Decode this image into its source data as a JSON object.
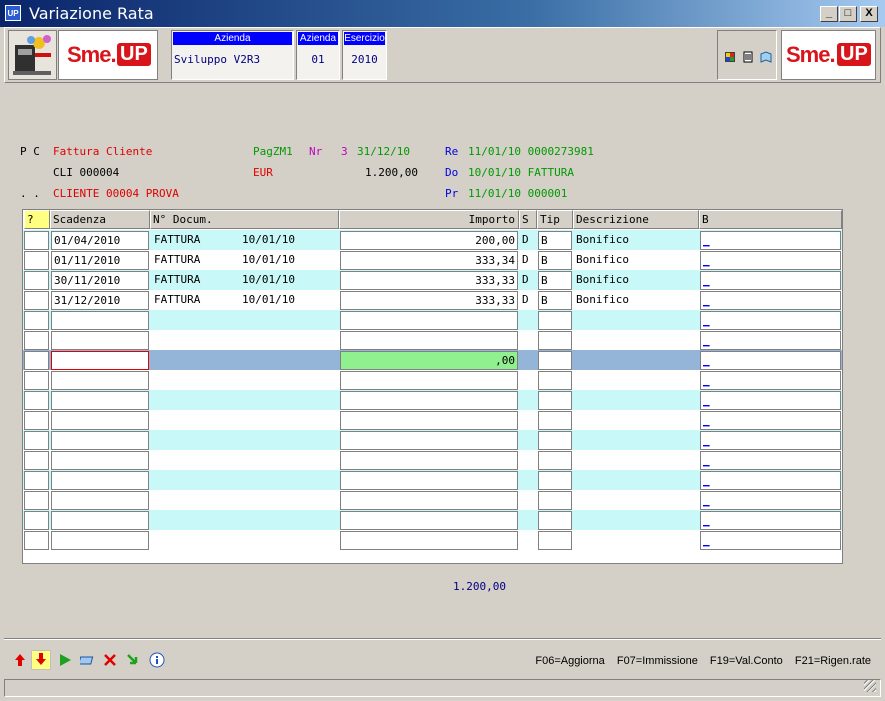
{
  "window": {
    "title": "Variazione Rata",
    "icon_label": "UP",
    "buttons": [
      "_",
      "□",
      "X"
    ]
  },
  "header": {
    "logo_sme": "Sme.",
    "logo_up": "UP",
    "azienda_desc_label": "Azienda",
    "azienda_desc_value": "Sviluppo V2R3",
    "azienda_label": "Azienda",
    "azienda_value": "01",
    "esercizio_label": "Esercizio",
    "esercizio_value": "2010"
  },
  "info": {
    "pc": "P C",
    "doc_type": "Fattura Cliente",
    "pag": "PagZM1",
    "nr_label": "Nr",
    "nr_value": "3",
    "nr_date": "31/12/10",
    "re_label": "Re",
    "re_value": "11/01/10 0000273981",
    "cli": "CLI 000004",
    "currency": "EUR",
    "amount": "1.200,00",
    "do_label": "Do",
    "do_value": "10/01/10 FATTURA",
    "dots": ". .",
    "client_name": "CLIENTE 00004 PROVA",
    "pr_label": "Pr",
    "pr_value": "11/01/10 000001"
  },
  "table": {
    "headers": {
      "q": "?",
      "scadenza": "Scadenza",
      "ndoc": "N° Docum.",
      "importo": "Importo",
      "s": "S",
      "tip": "Tip",
      "descr": "Descrizione",
      "b": "B"
    },
    "rows": [
      {
        "scadenza": "01/04/2010",
        "doc": "FATTURA",
        "docdate": "10/01/10",
        "importo": "200,00",
        "s": "D",
        "tip": "B",
        "descr": "Bonifico",
        "b": "_"
      },
      {
        "scadenza": "01/11/2010",
        "doc": "FATTURA",
        "docdate": "10/01/10",
        "importo": "333,34",
        "s": "D",
        "tip": "B",
        "descr": "Bonifico",
        "b": "_"
      },
      {
        "scadenza": "30/11/2010",
        "doc": "FATTURA",
        "docdate": "10/01/10",
        "importo": "333,33",
        "s": "D",
        "tip": "B",
        "descr": "Bonifico",
        "b": "_"
      },
      {
        "scadenza": "31/12/2010",
        "doc": "FATTURA",
        "docdate": "10/01/10",
        "importo": "333,33",
        "s": "D",
        "tip": "B",
        "descr": "Bonifico",
        "b": "_"
      },
      {
        "scadenza": "",
        "doc": "",
        "docdate": "",
        "importo": "",
        "s": "",
        "tip": "",
        "descr": "",
        "b": "_"
      },
      {
        "scadenza": "",
        "doc": "",
        "docdate": "",
        "importo": "",
        "s": "",
        "tip": "",
        "descr": "",
        "b": "_"
      },
      {
        "scadenza": "",
        "doc": "",
        "docdate": "",
        "importo": ",00",
        "s": "",
        "tip": "",
        "descr": "",
        "b": "_"
      },
      {
        "scadenza": "",
        "doc": "",
        "docdate": "",
        "importo": "",
        "s": "",
        "tip": "",
        "descr": "",
        "b": "_"
      },
      {
        "scadenza": "",
        "doc": "",
        "docdate": "",
        "importo": "",
        "s": "",
        "tip": "",
        "descr": "",
        "b": "_"
      },
      {
        "scadenza": "",
        "doc": "",
        "docdate": "",
        "importo": "",
        "s": "",
        "tip": "",
        "descr": "",
        "b": "_"
      },
      {
        "scadenza": "",
        "doc": "",
        "docdate": "",
        "importo": "",
        "s": "",
        "tip": "",
        "descr": "",
        "b": "_"
      },
      {
        "scadenza": "",
        "doc": "",
        "docdate": "",
        "importo": "",
        "s": "",
        "tip": "",
        "descr": "",
        "b": "_"
      },
      {
        "scadenza": "",
        "doc": "",
        "docdate": "",
        "importo": "",
        "s": "",
        "tip": "",
        "descr": "",
        "b": "_"
      },
      {
        "scadenza": "",
        "doc": "",
        "docdate": "",
        "importo": "",
        "s": "",
        "tip": "",
        "descr": "",
        "b": "_"
      },
      {
        "scadenza": "",
        "doc": "",
        "docdate": "",
        "importo": "",
        "s": "",
        "tip": "",
        "descr": "",
        "b": "_"
      },
      {
        "scadenza": "",
        "doc": "",
        "docdate": "",
        "importo": "",
        "s": "",
        "tip": "",
        "descr": "",
        "b": "_"
      }
    ]
  },
  "total": "1.200,00",
  "footer": {
    "fkeys": [
      "F06=Aggiorna",
      "F07=Immissione",
      "F19=Val.Conto",
      "F21=Rigen.rate"
    ],
    "icons": [
      "arrow-up-icon",
      "arrow-down-icon",
      "play-icon",
      "eraser-icon",
      "delete-icon",
      "refresh-icon",
      "info-icon"
    ]
  },
  "colors": {
    "row_cyan": "#c8f8f8",
    "row_selected": "#94b4d8",
    "active_amount": "#90f090",
    "label_blue": "#0000ff"
  }
}
